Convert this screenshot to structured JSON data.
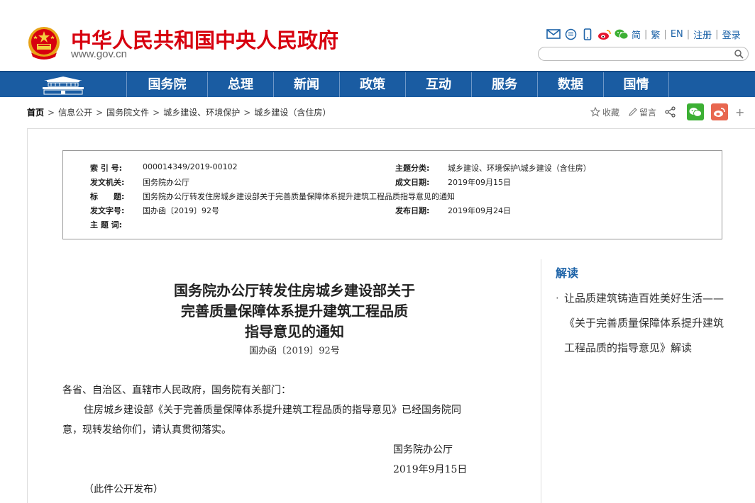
{
  "header": {
    "site_title": "中华人民共和国中央人民政府",
    "site_url": "www.gov.cn",
    "links": [
      "简",
      "繁",
      "EN",
      "注册",
      "登录"
    ],
    "search": {
      "placeholder": ""
    }
  },
  "nav": {
    "items": [
      "国务院",
      "总理",
      "新闻",
      "政策",
      "互动",
      "服务",
      "数据",
      "国情"
    ]
  },
  "breadcrumb": {
    "items": [
      "首页",
      "信息公开",
      "国务院文件",
      "城乡建设、环境保护",
      "城乡建设（含住房）"
    ]
  },
  "tools": {
    "favorite": "收藏",
    "comment": "留言"
  },
  "meta": {
    "index_label": "索 引 号:",
    "index_value": "000014349/2019-00102",
    "category_label": "主题分类:",
    "category_value": "城乡建设、环境保护\\城乡建设（含住房）",
    "issuer_label": "发文机关:",
    "issuer_value": "国务院办公厅",
    "written_label": "成文日期:",
    "written_value": "2019年09月15日",
    "title_label": "标　　题:",
    "title_value": "国务院办公厅转发住房城乡建设部关于完善质量保障体系提升建筑工程品质指导意见的通知",
    "docno_label": "发文字号:",
    "docno_value": "国办函〔2019〕92号",
    "published_label": "发布日期:",
    "published_value": "2019年09月24日",
    "keywords_label": "主 题 词:"
  },
  "article": {
    "title_line1": "国务院办公厅转发住房城乡建设部关于",
    "title_line2": "完善质量保障体系提升建筑工程品质",
    "title_line3": "指导意见的通知",
    "doc_number": "国办函〔2019〕92号",
    "salutation": "各省、自治区、直辖市人民政府，国务院有关部门：",
    "para1_line1": "住房城乡建设部《关于完善质量保障体系提升建筑工程品质的指导意见》已经国务院同",
    "para1_line2": "意，现转发给你们，请认真贯彻落实。",
    "signature": "国务院办公厅",
    "date": "2019年9月15日",
    "note": "（此件公开发布）"
  },
  "sidebar": {
    "title": "解读",
    "link_text": "让品质建筑铸造百姓美好生活——《关于完善质量保障体系提升建筑工程品质的指导意见》解读"
  },
  "colors": {
    "brand_red": "#d7000f",
    "nav_blue": "#1a5ca2",
    "link_blue": "#1d63a8",
    "wechat_green": "#3cb034",
    "weibo_red": "#e8674f"
  },
  "icons": [
    "national-emblem-icon",
    "mail-icon",
    "message-icon",
    "mobile-icon",
    "weibo-icon",
    "wechat-icon",
    "search-icon",
    "star-icon",
    "pen-icon",
    "share-icon",
    "plus-icon"
  ]
}
